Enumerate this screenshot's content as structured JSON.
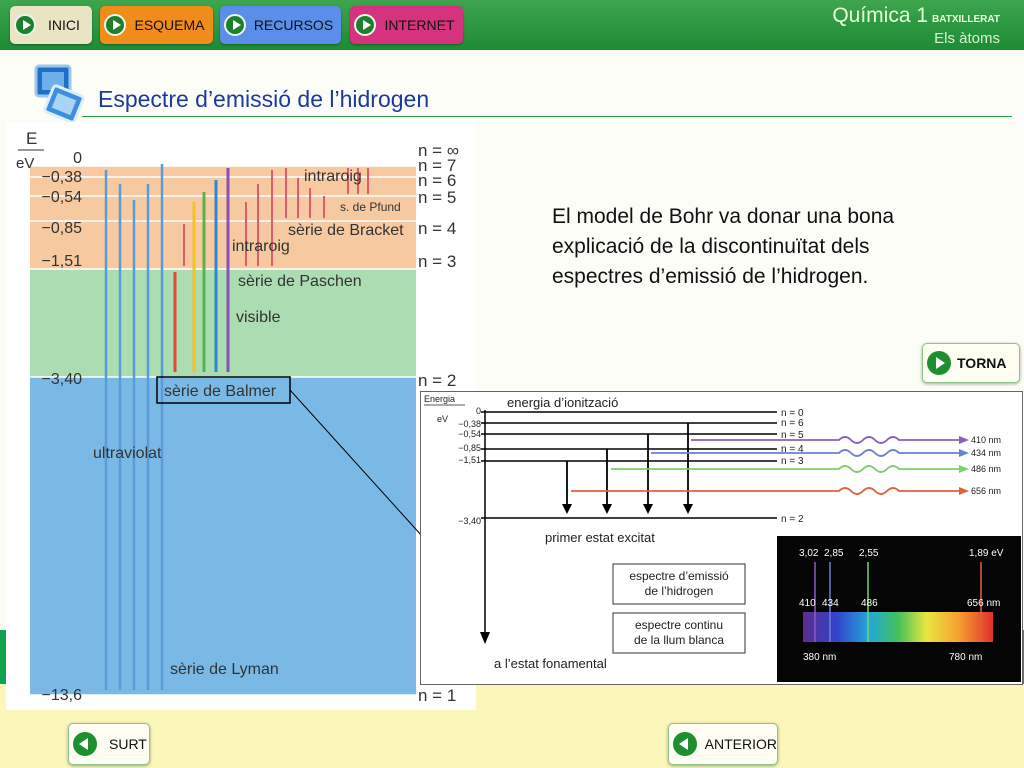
{
  "nav": {
    "inici": "INICI",
    "esquema": "ESQUEMA",
    "recursos": "RECURSOS",
    "internet": "INTERNET"
  },
  "brand": {
    "title": "Química 1",
    "edition": "BATXILLERAT",
    "unit": "Els àtoms"
  },
  "page": {
    "title": "Espectre d’emissió de l’hidrogen"
  },
  "text": {
    "lines": [
      "El model de Bohr va donar una bona",
      "explicació de la discontinuïtat dels",
      "espectres d’emissió de l’hidrogen."
    ]
  },
  "buttons": {
    "torna": "TORNA",
    "surt": "SURT",
    "anterior": "ANTERIOR"
  },
  "colors": {
    "topbar": "#2a9a40",
    "inici": "#e9e4c4",
    "esquema": "#f08c1a",
    "recursos": "#5a8ee8",
    "internet": "#d6337f",
    "zone_ir": "#f6c9a0",
    "zone_vis": "#abdcb2",
    "zone_uv": "#7ab9e6"
  },
  "left_figure": {
    "axis_e": "E",
    "axis_unit": "eV",
    "energies": [
      "0",
      "−0,38",
      "−0,54",
      "−0,85",
      "−1,51",
      "−3,40",
      "−13,6"
    ],
    "levels": [
      "n = ∞",
      "n = 7",
      "n = 6",
      "n = 5",
      "n = 4",
      "n = 3",
      "n = 2",
      "n = 1"
    ],
    "labels": {
      "intraroig_top": "intraroig",
      "pfund": "s. de Pfund",
      "bracket": "sèrie de Bracket",
      "intraroig_mid": "intraroig",
      "paschen": "sèrie de Paschen",
      "visible": "visible",
      "balmer": "sèrie de Balmer",
      "ultraviolat": "ultraviolat",
      "lyman": "sèrie de Lyman"
    }
  },
  "right_figure": {
    "axis": "Energia",
    "unit": "eV",
    "energies": [
      "0",
      "−0,38",
      "−0,54",
      "−0,85",
      "−1,51",
      "−3,40"
    ],
    "levels": [
      "n = 0",
      "n = 6",
      "n = 5",
      "n = 4",
      "n = 3",
      "n = 2"
    ],
    "ionization": "energia d’ionització",
    "excited": "primer estat excitat",
    "ground": "a l’estat fonamental",
    "box1": [
      "espectre d’emissió",
      "de l’hidrogen"
    ],
    "box2": [
      "espectre continu",
      "de la llum blanca"
    ],
    "wavelengths": [
      "410 nm",
      "434 nm",
      "486 nm",
      "656 nm"
    ],
    "spectrum_top": [
      "3,02",
      "2,85",
      "2,55",
      "1,89 eV"
    ],
    "spectrum_mid": [
      "410",
      "434",
      "486",
      "656 nm"
    ],
    "spectrum_bottom": [
      "380 nm",
      "780 nm"
    ]
  }
}
